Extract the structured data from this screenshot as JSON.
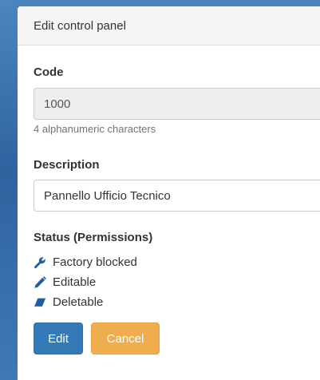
{
  "panel": {
    "title": "Edit control panel"
  },
  "code": {
    "label": "Code",
    "value": "1000",
    "help": "4 alphanumeric characters"
  },
  "description": {
    "label": "Description",
    "value": "Pannello Ufficio Tecnico"
  },
  "status": {
    "label": "Status (Permissions)",
    "items": [
      {
        "icon": "wrench-icon",
        "label": "Factory blocked"
      },
      {
        "icon": "pencil-icon",
        "label": "Editable"
      },
      {
        "icon": "eraser-icon",
        "label": "Deletable"
      }
    ]
  },
  "actions": {
    "edit_label": "Edit",
    "cancel_label": "Cancel"
  },
  "colors": {
    "primary": "#337ab7",
    "warning": "#f0ad4e",
    "icon": "#1f5fa0"
  }
}
